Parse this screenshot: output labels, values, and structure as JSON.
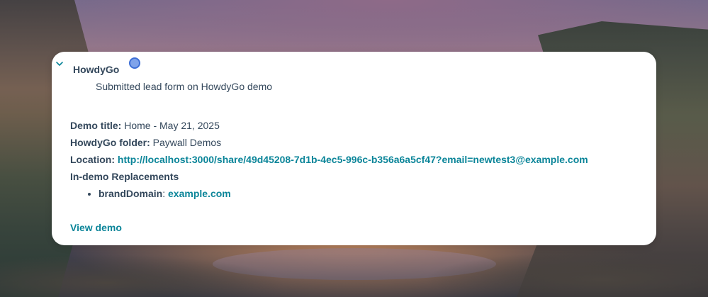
{
  "background": {
    "description_icon": "landscape-wallpaper"
  },
  "card": {
    "header_title": "HowdyGo",
    "subtitle": "Submitted lead form on HowdyGo demo",
    "status_color": "#7fa3ea",
    "fields": {
      "demo_title_label": "Demo title:",
      "demo_title_value": "Home - May 21, 2025",
      "folder_label": "HowdyGo folder:",
      "folder_value": "Paywall Demos",
      "location_label": "Location:",
      "location_value": "http://localhost:3000/share/49d45208-7d1b-4ec5-996c-b356a6a5cf47?email=newtest3@example.com"
    },
    "replacements": {
      "heading": "In-demo Replacements",
      "items": [
        {
          "key": "brandDomain",
          "separator": ":",
          "value": "example.com"
        }
      ]
    },
    "view_demo_label": "View demo",
    "link_color": "#0b8599",
    "text_color": "#33475b"
  }
}
